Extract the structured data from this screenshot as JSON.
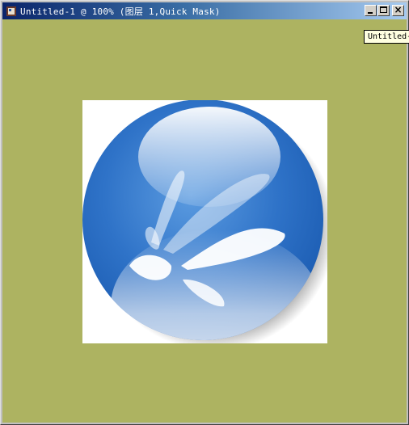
{
  "window": {
    "title": "Untitled-1 @ 100% (图层 1,Quick Mask)",
    "buttons": {
      "minimize_icon": "minimize-icon",
      "maximize_icon": "maximize-icon",
      "close_icon": "close-icon"
    }
  },
  "tooltip": {
    "text": "Untitled-"
  },
  "canvas": {
    "background_color": "#adb361",
    "document_background": "#ffffff",
    "artwork": "blue-glass-sphere-logo"
  },
  "colors": {
    "titlebar_start": "#0a246a",
    "titlebar_end": "#a6caf0",
    "sphere_blue": "#2a6cc4"
  }
}
